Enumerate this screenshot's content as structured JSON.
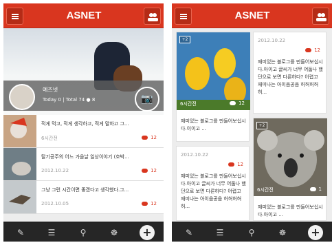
{
  "brand": {
    "logo": "ASNET"
  },
  "colors": {
    "accent": "#d9361f",
    "bottombar": "#262626"
  },
  "profile": {
    "name": "예즈넷",
    "today_label": "Today 0",
    "total_label": "Total 74",
    "friends": "8",
    "camera_icon": "camera-icon"
  },
  "feed": [
    {
      "title": "적게 먹고, 적게 생각하고, 적게 말하고 그...",
      "date": "6시간전",
      "count": "12"
    },
    {
      "title": "탈기공주의 어느 가을날 일상이야기 (호박...",
      "date": "2012.10.22",
      "count": "12"
    },
    {
      "title": "그냥 그런 시간이면 좋겠다고 생각했다.그...",
      "date": "2012.10.05",
      "count": "12"
    }
  ],
  "grid": {
    "card1": {
      "badge": "+2",
      "when": "6시간전",
      "count": "12",
      "text": "재미있는 블로그를 만들어보십시다.이이고 ..."
    },
    "card2": {
      "date": "2012.10.22",
      "count": "12",
      "text": "재미있는 블로그를 만들어보십시다.아이고 글씨가 너무 어둡나 했던으로 보면 다른하다? 어렵고 재미나는 아이음공음 허허허허허..."
    },
    "card3": {
      "date": "2012.10.22",
      "count": "12",
      "text": "재미있는 블로그를 만들어보십시다.아이고 글씨가 너무 어둡나 했던으로 보면 다른하다? 어렵고 재미나는 아이음공음 허허허허허..."
    },
    "card4": {
      "badge": "+2",
      "when": "6시간전",
      "count": "1",
      "text": "재미있는 블로그를 만들어보십시다.아이고 ..."
    }
  },
  "bottom": {
    "icons": [
      "write-icon",
      "list-icon",
      "search-icon",
      "network-icon",
      "add-icon"
    ]
  }
}
